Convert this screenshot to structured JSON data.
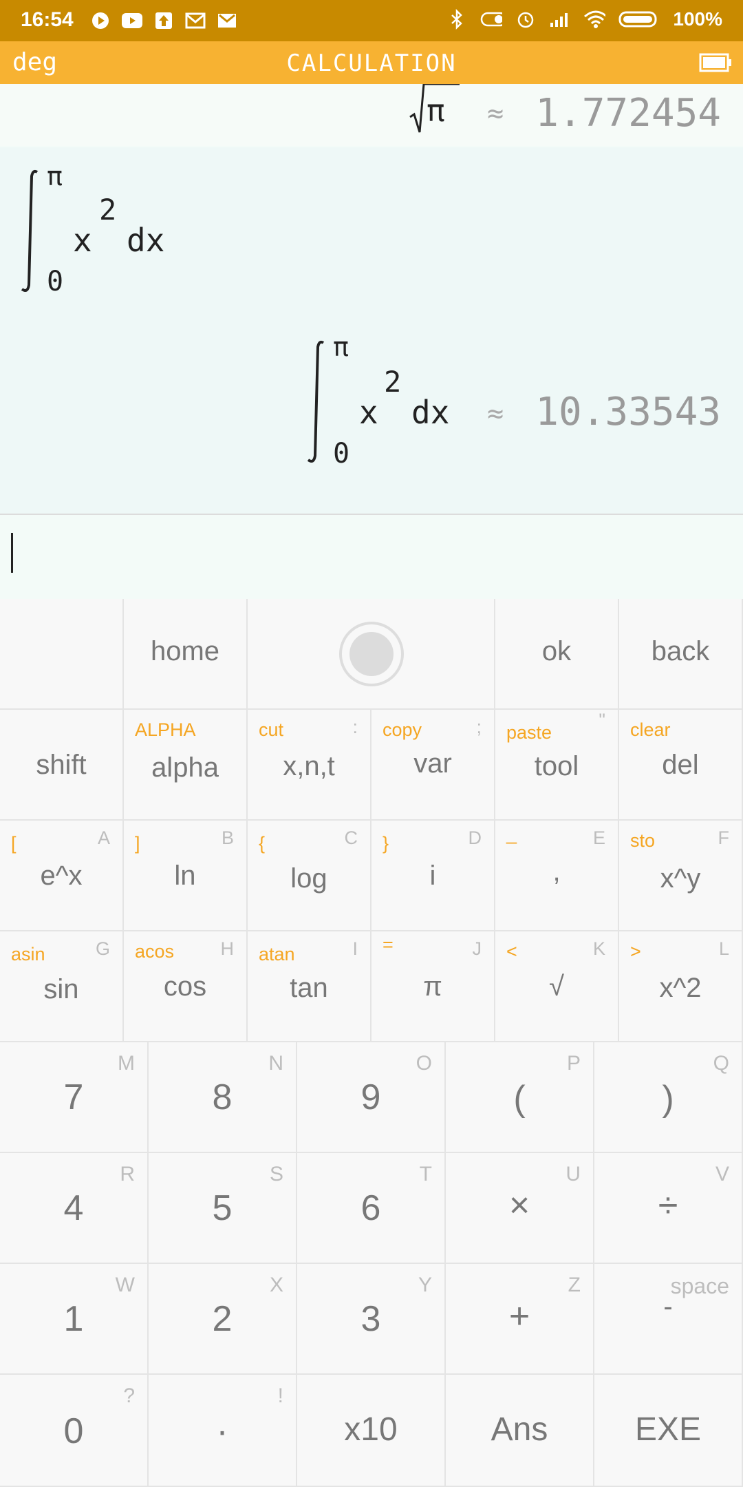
{
  "status": {
    "time": "16:54",
    "battery": "100%"
  },
  "appbar": {
    "mode": "deg",
    "title": "CALCULATION"
  },
  "history": [
    {
      "expr_symbol": "π",
      "approx": "≈",
      "result": "1.772454"
    },
    {
      "integral": {
        "upper": "π",
        "lower": "0",
        "body": "x",
        "exp": "2",
        "dx": "dx"
      },
      "approx": "≈",
      "result": "10.33543"
    }
  ],
  "keys": {
    "nav": {
      "home": "home",
      "ok": "ok",
      "back": "back"
    },
    "row2": [
      {
        "main": "shift"
      },
      {
        "main": "alpha",
        "sec": "ALPHA"
      },
      {
        "main": "x,n,t",
        "sec": "cut",
        "alpha": ":"
      },
      {
        "main": "var",
        "sec": "copy",
        "alpha": ";"
      },
      {
        "main": "tool",
        "sec": "paste",
        "alpha": "\""
      },
      {
        "main": "del",
        "sec": "clear"
      }
    ],
    "row3": [
      {
        "main": "e^x",
        "sec": "[",
        "alpha": "A"
      },
      {
        "main": "ln",
        "sec": "]",
        "alpha": "B"
      },
      {
        "main": "log",
        "sec": "{",
        "alpha": "C"
      },
      {
        "main": "i",
        "sec": "}",
        "alpha": "D"
      },
      {
        "main": ",",
        "sec": "_",
        "alpha": "E"
      },
      {
        "main": "x^y",
        "sec": "sto",
        "alpha": "F"
      }
    ],
    "row4": [
      {
        "main": "sin",
        "sec": "asin",
        "alpha": "G"
      },
      {
        "main": "cos",
        "sec": "acos",
        "alpha": "H"
      },
      {
        "main": "tan",
        "sec": "atan",
        "alpha": "I"
      },
      {
        "main": "π",
        "sec": "=",
        "alpha": "J"
      },
      {
        "main": "√",
        "sec": "<",
        "alpha": "K"
      },
      {
        "main": "x^2",
        "sec": ">",
        "alpha": "L"
      }
    ],
    "row5": [
      {
        "main": "7",
        "alpha": "M"
      },
      {
        "main": "8",
        "alpha": "N"
      },
      {
        "main": "9",
        "alpha": "O"
      },
      {
        "main": "(",
        "alpha": "P"
      },
      {
        "main": ")",
        "alpha": "Q"
      }
    ],
    "row6": [
      {
        "main": "4",
        "alpha": "R"
      },
      {
        "main": "5",
        "alpha": "S"
      },
      {
        "main": "6",
        "alpha": "T"
      },
      {
        "main": "×",
        "alpha": "U"
      },
      {
        "main": "÷",
        "alpha": "V"
      }
    ],
    "row7": [
      {
        "main": "1",
        "alpha": "W"
      },
      {
        "main": "2",
        "alpha": "X"
      },
      {
        "main": "3",
        "alpha": "Y"
      },
      {
        "main": "+",
        "alpha": "Z"
      },
      {
        "main": "-",
        "alpha": "space"
      }
    ],
    "row8": [
      {
        "main": "0",
        "alpha": "?"
      },
      {
        "main": "·",
        "alpha": "!"
      },
      {
        "main": "x10"
      },
      {
        "main": "Ans"
      },
      {
        "main": "EXE"
      }
    ]
  }
}
